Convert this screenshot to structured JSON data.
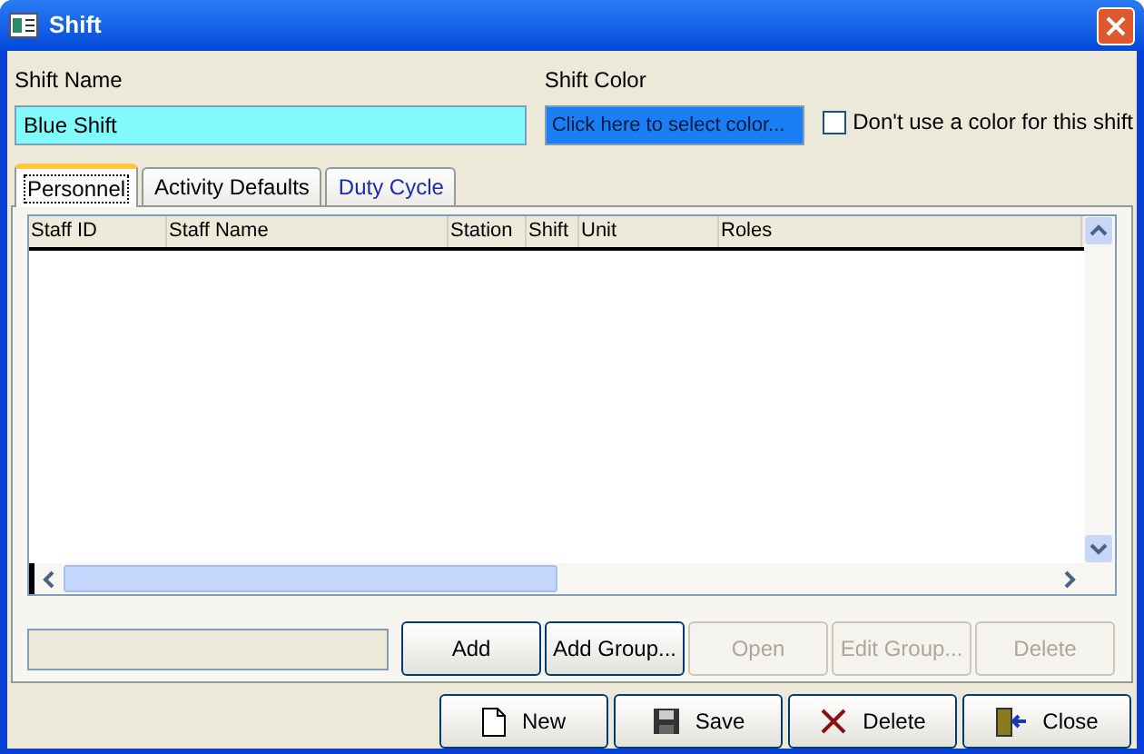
{
  "window": {
    "title": "Shift"
  },
  "shift_name": {
    "label": "Shift Name",
    "value": "Blue Shift"
  },
  "shift_color": {
    "label": "Shift Color",
    "value": "Click here to select color...",
    "color": "#1a7ef5"
  },
  "no_color_checkbox": {
    "label": "Don't use a color for this shift",
    "checked": false
  },
  "tabs": [
    {
      "label": "Personnel",
      "selected": true,
      "hot": false
    },
    {
      "label": "Activity Defaults",
      "selected": false,
      "hot": false
    },
    {
      "label": "Duty Cycle",
      "selected": false,
      "hot": true
    }
  ],
  "table": {
    "columns": [
      "Staff ID",
      "Staff Name",
      "Station",
      "Shift",
      "Unit",
      "Roles"
    ]
  },
  "panel_buttons": [
    {
      "label": "Add",
      "disabled": false
    },
    {
      "label": "Add Group...",
      "disabled": false
    },
    {
      "label": "Open",
      "disabled": true
    },
    {
      "label": "Edit Group...",
      "disabled": true
    },
    {
      "label": "Delete",
      "disabled": true
    }
  ],
  "footer_buttons": [
    {
      "label": "New",
      "kind": "new"
    },
    {
      "label": "Save",
      "kind": "save"
    },
    {
      "label": "Delete",
      "kind": "delete"
    },
    {
      "label": "Close",
      "kind": "close"
    }
  ]
}
